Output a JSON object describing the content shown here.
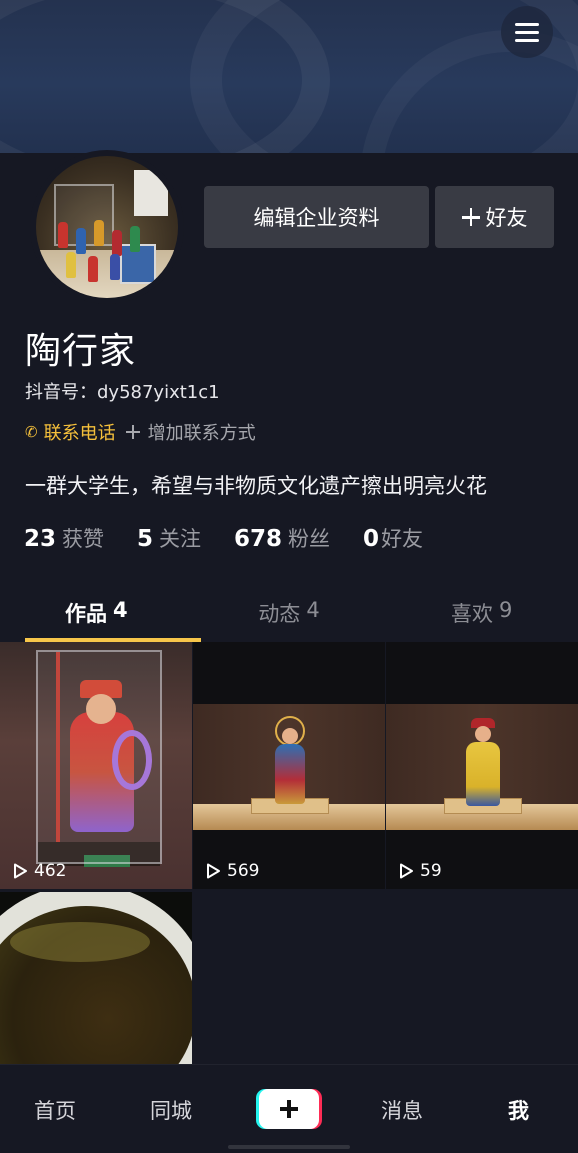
{
  "colors": {
    "background": "#161823",
    "accent_yellow": "#f5c03b",
    "tab_underline": "#f7c64a",
    "button_bg": "#393b44",
    "create_cyan": "#25f4ee",
    "create_red": "#fe2c55"
  },
  "header": {
    "menu_icon": "hamburger-menu-icon"
  },
  "profile": {
    "name": "陶行家",
    "douyin_id": "抖音号：dy587yixt1c1",
    "edit_button_label": "编辑企业资料",
    "add_friend_label": "好友",
    "contact_phone_label": "联系电话",
    "add_contact_label": "增加联系方式",
    "bio": "一群大学生，希望与非物质文化遗产擦出明亮火花"
  },
  "stats": [
    {
      "value": "23",
      "label": "获赞"
    },
    {
      "value": "5",
      "label": "关注"
    },
    {
      "value": "678",
      "label": "粉丝"
    },
    {
      "value": "0",
      "label": "好友"
    }
  ],
  "tabs": [
    {
      "label": "作品",
      "count": "4",
      "active": true
    },
    {
      "label": "动态",
      "count": "4",
      "active": false
    },
    {
      "label": "喜欢",
      "count": "9",
      "active": false
    }
  ],
  "videos": [
    {
      "views": "462"
    },
    {
      "views": "569"
    },
    {
      "views": "59"
    },
    {
      "views": ""
    }
  ],
  "bottom_nav": {
    "home": "首页",
    "nearby": "同城",
    "messages": "消息",
    "me": "我"
  }
}
